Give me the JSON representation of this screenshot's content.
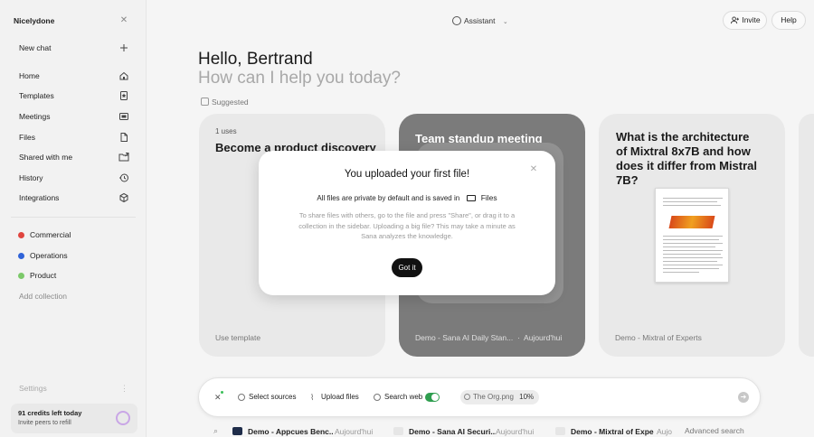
{
  "sidebar": {
    "workspace": "Nicelydone",
    "new_chat": "New chat",
    "items": [
      {
        "label": "Home"
      },
      {
        "label": "Templates"
      },
      {
        "label": "Meetings"
      },
      {
        "label": "Files"
      },
      {
        "label": "Shared with me"
      },
      {
        "label": "History"
      },
      {
        "label": "Integrations"
      }
    ],
    "collections": [
      {
        "label": "Commercial",
        "color": "#e0453f"
      },
      {
        "label": "Operations",
        "color": "#2f63d8"
      },
      {
        "label": "Product",
        "color": "#7cc96a"
      }
    ],
    "add_collection": "Add collection",
    "settings": "Settings",
    "credits_line": "91 credits left today",
    "credits_sub": "Invite peers to refill"
  },
  "topbar": {
    "assistant": "Assistant",
    "invite": "Invite",
    "help": "Help"
  },
  "greeting": {
    "hello": "Hello, Bertrand",
    "prompt": "How can I help you today?",
    "suggested": "Suggested"
  },
  "cards": [
    {
      "uses": "1 uses",
      "title": "Become a product discovery",
      "footer": "Use template"
    },
    {
      "title": "Team standup meeting",
      "footer": "Demo - Sana AI Daily Stan...",
      "date": "Aujourd'hui"
    },
    {
      "title": "What is the architecture of Mixtral 8x7B and how does it differ from Mistral 7B?",
      "footer": "Demo - Mixtral of Experts"
    }
  ],
  "modal": {
    "title": "You uploaded your first file!",
    "line": "All files are private by default and is saved in",
    "files_label": "Files",
    "description": "To share files with others, go to the file and press \"Share\", or drag it to a collection in the sidebar. Uploading a big file? This may take a minute as Sana analyzes the knowledge.",
    "button": "Got it"
  },
  "composer": {
    "select_sources": "Select sources",
    "upload_files": "Upload files",
    "search_web": "Search web",
    "search_web_on": true,
    "attachment": "The Org.png",
    "attachment_progress": "10%"
  },
  "recent": [
    {
      "name": "Demo - Appcues Benc...",
      "date": "Aujourd'hui"
    },
    {
      "name": "Demo - Sana AI Securi...",
      "date": "Aujourd'hui"
    },
    {
      "name": "Demo - Mixtral of Expe...",
      "date": "Aujo"
    }
  ],
  "advanced_search": "Advanced search"
}
